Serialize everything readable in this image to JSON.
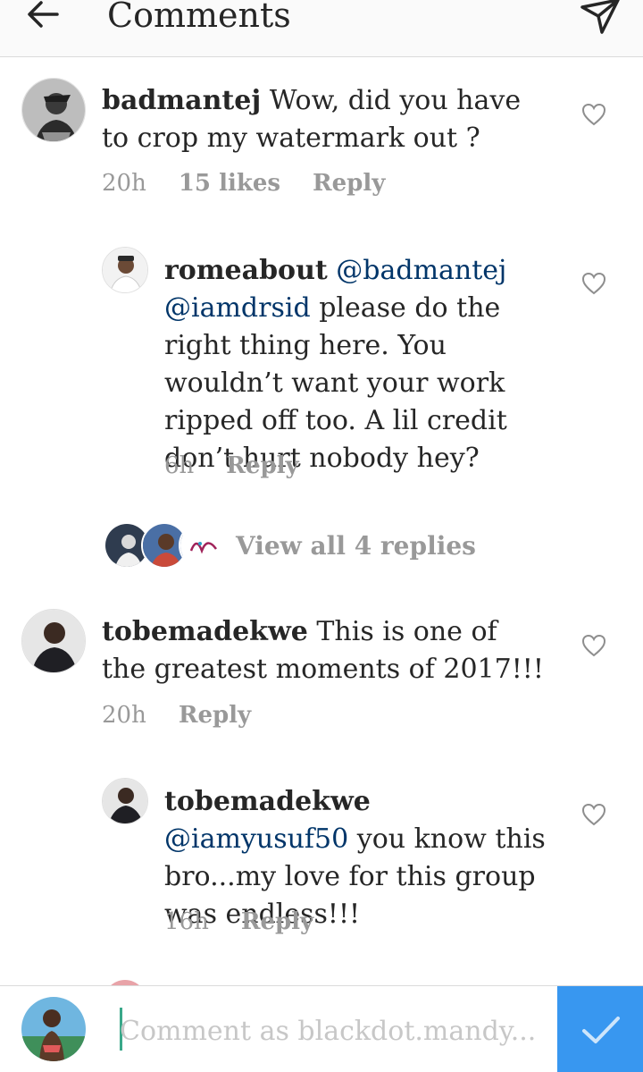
{
  "header": {
    "title": "Comments",
    "back_icon": "arrow-left-icon",
    "send_icon": "paper-plane-icon"
  },
  "comments": [
    {
      "username": "badmantej",
      "text": " Wow, did you have to crop my watermark out ?",
      "time": "20h",
      "likes": "15 likes",
      "reply": "Reply"
    },
    {
      "username": "romeabout",
      "mention1": "@badmantej",
      "mention2": "@iamdrsid",
      "text": " please do the right thing here. You wouldn’t want your work ripped off too. A lil credit don’t hurt nobody hey?",
      "time": "6h",
      "reply": "Reply"
    },
    {
      "view_replies": "View all 4 replies"
    },
    {
      "username": "tobemadekwe",
      "text": " This is one of the greatest moments of 2017!!!",
      "time": "20h",
      "reply": "Reply"
    },
    {
      "username": "tobemadekwe",
      "mention1": "@iamyusuf50",
      "text": " you know this bro...my love for this group was endless!!!",
      "time": "16h",
      "reply": "Reply"
    }
  ],
  "composer": {
    "placeholder": "Comment as blackdot.mandy...",
    "post_icon": "checkmark-icon"
  },
  "colors": {
    "accent": "#3897f0",
    "mention": "#003569",
    "muted": "#999999"
  }
}
